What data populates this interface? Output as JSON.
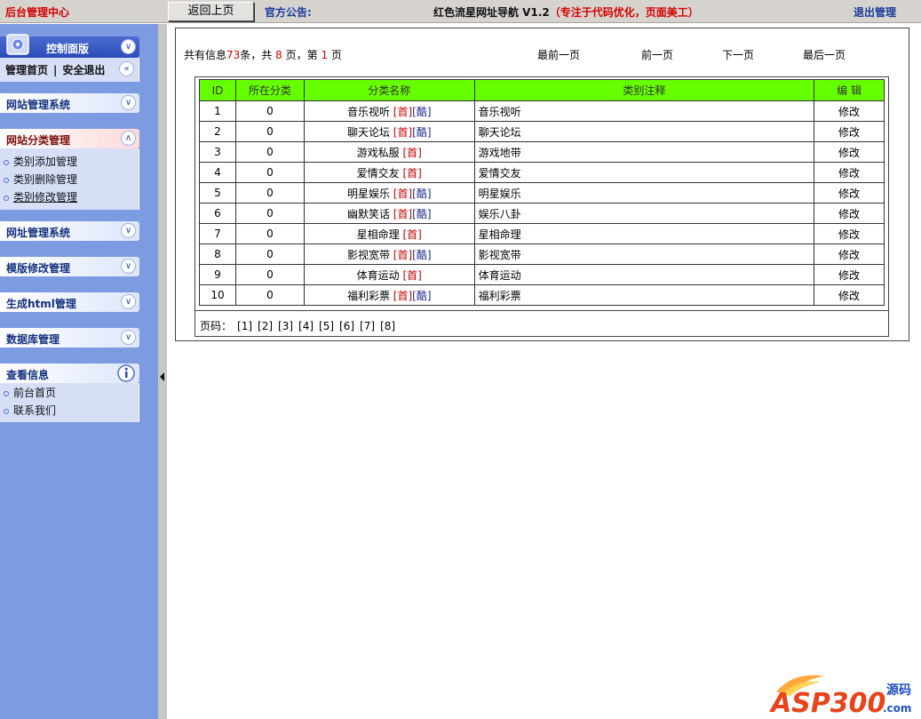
{
  "topbar": {
    "brand": "后台管理中心",
    "back_button": "返回上页",
    "notice_label": "官方公告:",
    "site_title": "红色流星网址导航 V1.2",
    "site_slogan": "（专注于代码优化，页面美工）",
    "logout": "退出管理"
  },
  "sidebar": {
    "control_title": "控制面版",
    "quick_home": "管理首页",
    "quick_sep": "|",
    "quick_logout": "安全退出",
    "sections": [
      {
        "label": "网站管理系统"
      },
      {
        "label": "网站分类管理"
      },
      {
        "label": "网址管理系统"
      },
      {
        "label": "模版修改管理"
      },
      {
        "label": "生成html管理"
      },
      {
        "label": "数据库管理"
      }
    ],
    "category_items": [
      "类别添加管理",
      "类别删除管理",
      "类别修改管理"
    ],
    "info_title": "查看信息",
    "info_items": [
      "前台首页",
      "联系我们"
    ]
  },
  "summary": {
    "prefix": "共有信息",
    "total": "73",
    "unit": "条，共",
    "pages": "8",
    "pages_unit": "页，第",
    "current": "1",
    "current_unit": "页"
  },
  "pager": {
    "first": "最前一页",
    "prev": "前一页",
    "next": "下一页",
    "last": "最后一页"
  },
  "table": {
    "headers": [
      "ID",
      "所在分类",
      "分类名称",
      "类别注释",
      "编 辑"
    ],
    "rows": [
      {
        "id": "1",
        "cat": "0",
        "name": "音乐视听",
        "tag1": "[首]",
        "tag2": "[酷]",
        "note": "音乐视听",
        "edit": "修改"
      },
      {
        "id": "2",
        "cat": "0",
        "name": "聊天论坛",
        "tag1": "[首]",
        "tag2": "[酷]",
        "note": "聊天论坛",
        "edit": "修改"
      },
      {
        "id": "3",
        "cat": "0",
        "name": "游戏私服",
        "tag1": "[首]",
        "tag2": "",
        "note": "游戏地带",
        "edit": "修改"
      },
      {
        "id": "4",
        "cat": "0",
        "name": "爱情交友",
        "tag1": "[首]",
        "tag2": "",
        "note": "爱情交友",
        "edit": "修改"
      },
      {
        "id": "5",
        "cat": "0",
        "name": "明星娱乐",
        "tag1": "[首]",
        "tag2": "[酷]",
        "note": "明星娱乐",
        "edit": "修改"
      },
      {
        "id": "6",
        "cat": "0",
        "name": "幽默笑话",
        "tag1": "[首]",
        "tag2": "[酷]",
        "note": "娱乐八卦",
        "edit": "修改"
      },
      {
        "id": "7",
        "cat": "0",
        "name": "星相命理",
        "tag1": "[首]",
        "tag2": "",
        "note": "星相命理",
        "edit": "修改"
      },
      {
        "id": "8",
        "cat": "0",
        "name": "影视宽带",
        "tag1": "[首]",
        "tag2": "[酷]",
        "note": "影视宽带",
        "edit": "修改"
      },
      {
        "id": "9",
        "cat": "0",
        "name": "体育运动",
        "tag1": "[首]",
        "tag2": "",
        "note": "体育运动",
        "edit": "修改"
      },
      {
        "id": "10",
        "cat": "0",
        "name": "福利彩票",
        "tag1": "[首]",
        "tag2": "[酷]",
        "note": "福利彩票",
        "edit": "修改"
      }
    ]
  },
  "page_list": {
    "label": "页码：",
    "pages": [
      "[1]",
      "[2]",
      "[3]",
      "[4]",
      "[5]",
      "[6]",
      "[7]",
      "[8]"
    ]
  },
  "watermark": {
    "text": "ASP300",
    "suffix": "源码",
    "domain": ".com"
  }
}
